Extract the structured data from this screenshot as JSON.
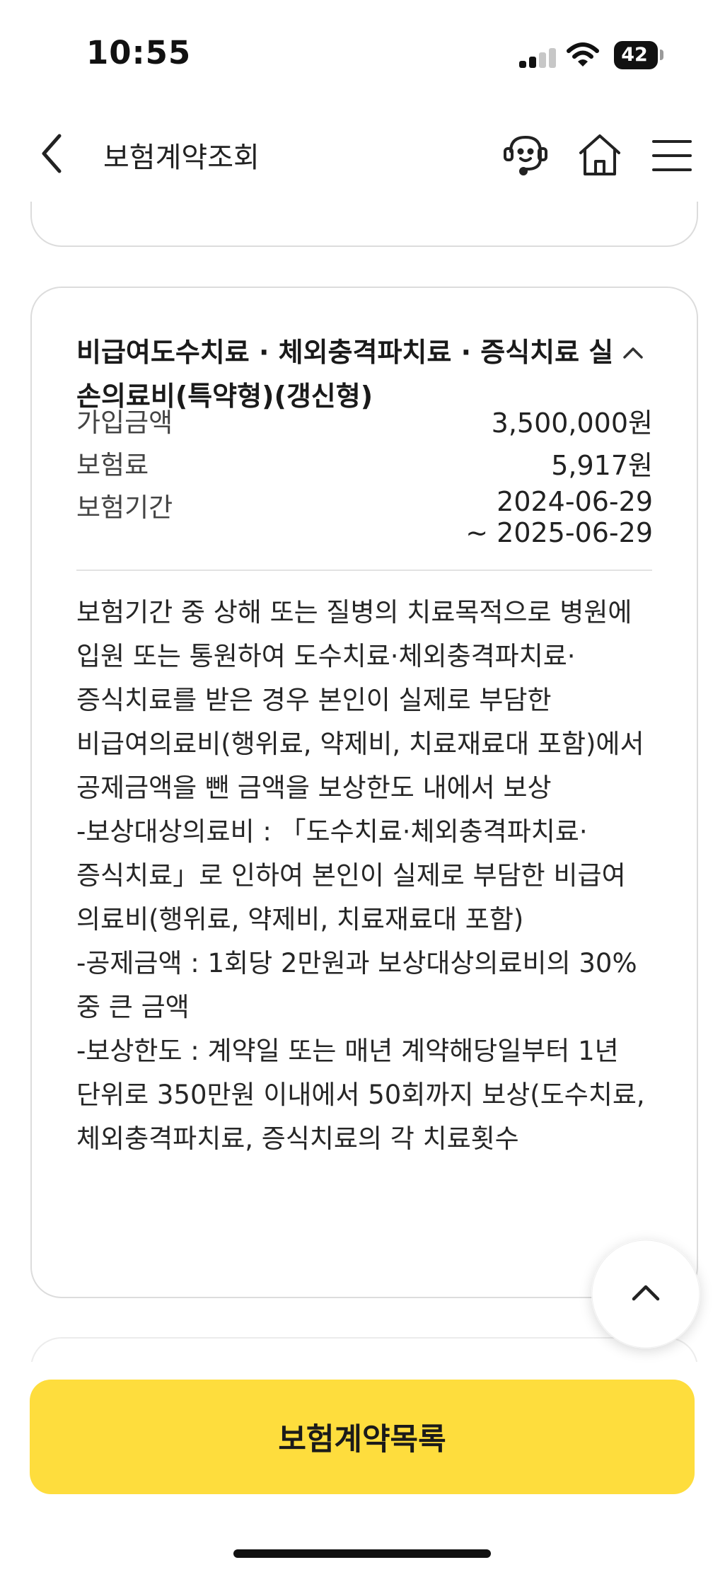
{
  "status_bar": {
    "time": "10:55",
    "battery": "42"
  },
  "header": {
    "title": "보험계약조회"
  },
  "coverage": {
    "title": "비급여도수치료 · 체외충격파치료 · 증식치료 실손의료비(특약형)(갱신형)",
    "rows": [
      {
        "label": "가입금액",
        "value": "3,500,000원"
      },
      {
        "label": "보험료",
        "value": "5,917원"
      },
      {
        "label": "보험기간",
        "value_start": "2024-06-29",
        "value_end": "~ 2025-06-29"
      }
    ],
    "description": "보험기간 중 상해 또는 질병의 치료목적으로 병원에 입원 또는 통원하여 도수치료·체외충격파치료·증식치료를 받은 경우 본인이 실제로 부담한 비급여의료비(행위료, 약제비, 치료재료대 포함)에서 공제금액을 뺀 금액을 보상한도 내에서 보상\n-보상대상의료비 : 「도수치료·체외충격파치료·증식치료」로 인하여 본인이 실제로 부담한 비급여 의료비(행위료, 약제비, 치료재료대 포함)\n-공제금액 : 1회당 2만원과 보상대상의료비의 30% 중 큰 금액\n-보상한도 : 계약일 또는 매년 계약해당일부터 1년 단위로 350만원 이내에서 50회까지 보상(도수치료, 체외충격파치료, 증식치료의 각 치료횟수"
  },
  "footer": {
    "primary_button": "보험계약목록"
  },
  "icons": {
    "back": "chevron-left-icon",
    "chatbot": "chatbot-icon",
    "home": "home-icon",
    "menu": "hamburger-menu-icon",
    "collapse": "chevron-up-icon",
    "scroll_top": "chevron-up-icon"
  },
  "colors": {
    "accent": "#fedd3d",
    "card_border": "#dcdcdc"
  }
}
